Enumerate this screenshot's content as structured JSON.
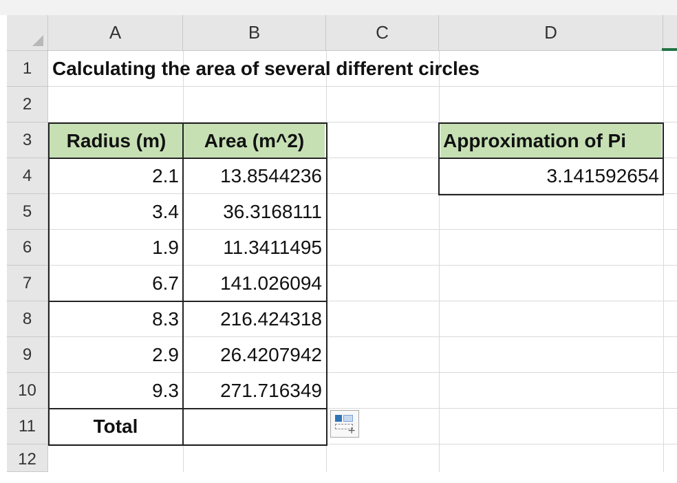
{
  "columns": [
    "A",
    "B",
    "C",
    "D"
  ],
  "rows": [
    "1",
    "2",
    "3",
    "4",
    "5",
    "6",
    "7",
    "8",
    "9",
    "10",
    "11",
    "12"
  ],
  "title": "Calculating the area of several different circles",
  "table": {
    "header_radius": "Radius (m)",
    "header_area": "Area (m^2)",
    "rows": [
      {
        "radius": "2.1",
        "area": "13.8544236"
      },
      {
        "radius": "3.4",
        "area": "36.3168111"
      },
      {
        "radius": "1.9",
        "area": "11.3411495"
      },
      {
        "radius": "6.7",
        "area": "141.026094"
      },
      {
        "radius": "8.3",
        "area": "216.424318"
      },
      {
        "radius": "2.9",
        "area": "26.4207942"
      },
      {
        "radius": "9.3",
        "area": "271.716349"
      }
    ],
    "total_label": "Total",
    "total_value": ""
  },
  "pi": {
    "header": "Approximation of Pi",
    "value": "3.141592654"
  },
  "colors": {
    "header_fill": "#c6e0b4",
    "grid": "#d9d9d9",
    "headings_bg": "#e6e6e6"
  },
  "icons": {
    "quick_analysis": "quick-analysis-icon",
    "select_all": "select-all-triangle-icon"
  }
}
